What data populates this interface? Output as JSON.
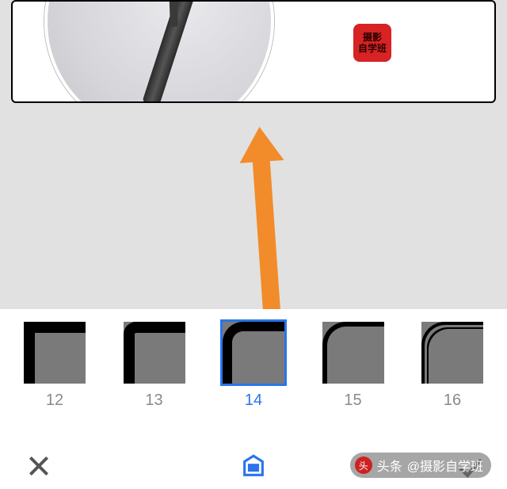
{
  "stamp": {
    "line1": "摄影",
    "line2": "自学班"
  },
  "frames": [
    {
      "id": "12",
      "label": "12",
      "selected": false
    },
    {
      "id": "13",
      "label": "13",
      "selected": false
    },
    {
      "id": "14",
      "label": "14",
      "selected": true
    },
    {
      "id": "15",
      "label": "15",
      "selected": false
    },
    {
      "id": "16",
      "label": "16",
      "selected": false
    }
  ],
  "watermark": {
    "prefix": "头条",
    "author": "@摄影自学班"
  },
  "colors": {
    "accent": "#2a74ed",
    "arrow": "#f28b2a",
    "stamp": "#d72323"
  }
}
